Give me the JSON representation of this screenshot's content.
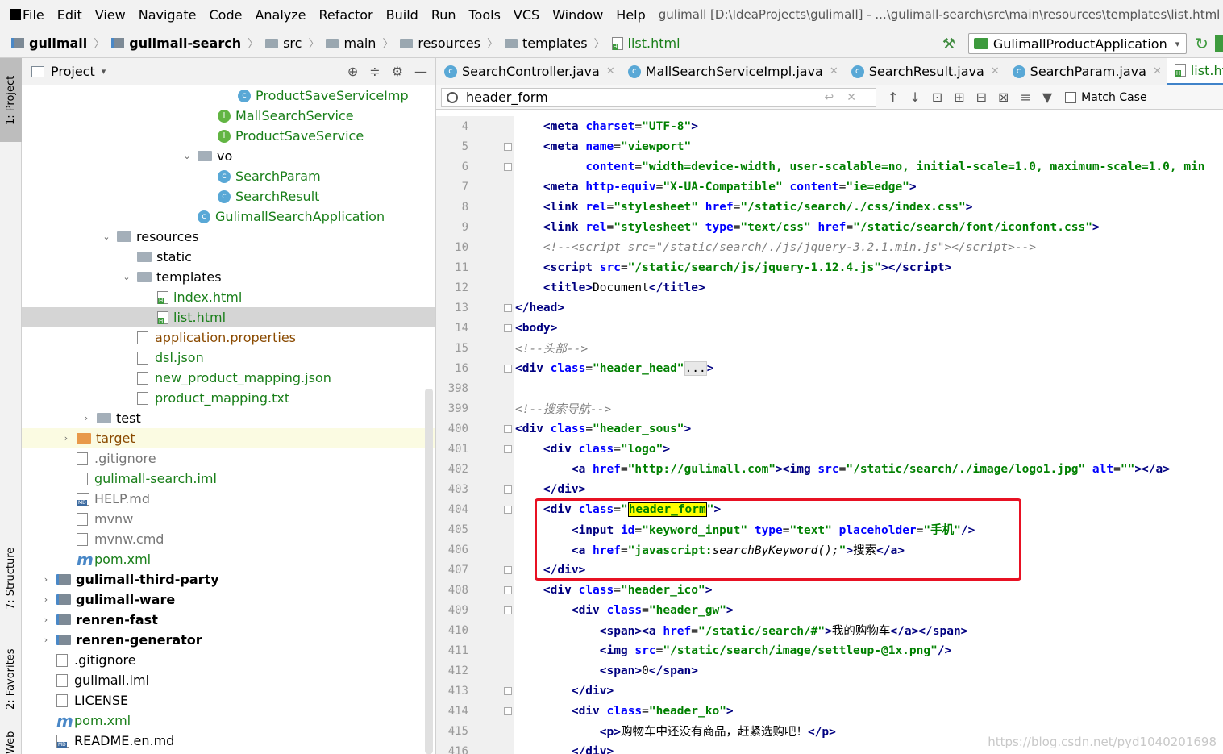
{
  "menu": [
    "File",
    "Edit",
    "View",
    "Navigate",
    "Code",
    "Analyze",
    "Refactor",
    "Build",
    "Run",
    "Tools",
    "VCS",
    "Window",
    "Help"
  ],
  "window_title": "gulimall [D:\\IdeaProjects\\gulimall] - ...\\gulimall-search\\src\\main\\resources\\templates\\list.html [gulima",
  "breadcrumbs": [
    "gulimall",
    "gulimall-search",
    "src",
    "main",
    "resources",
    "templates",
    "list.html"
  ],
  "run_config": "GulimallProductApplication",
  "sidebar_tabs": [
    "1: Project",
    "7: Structure",
    "2: Favorites",
    "Web"
  ],
  "project_panel_title": "Project",
  "tree": [
    {
      "label": "ProductSaveServiceImp",
      "icon": "class",
      "indent": 10,
      "color": "green"
    },
    {
      "label": "MallSearchService",
      "icon": "interface",
      "indent": 9,
      "color": "green"
    },
    {
      "label": "ProductSaveService",
      "icon": "interface",
      "indent": 9,
      "color": "green"
    },
    {
      "label": "vo",
      "icon": "folder",
      "indent": 8,
      "arrow": "open"
    },
    {
      "label": "SearchParam",
      "icon": "class",
      "indent": 9,
      "color": "green"
    },
    {
      "label": "SearchResult",
      "icon": "class",
      "indent": 9,
      "color": "green"
    },
    {
      "label": "GulimallSearchApplication",
      "icon": "class",
      "indent": 8,
      "color": "green"
    },
    {
      "label": "resources",
      "icon": "folder",
      "indent": 4,
      "arrow": "open"
    },
    {
      "label": "static",
      "icon": "folder",
      "indent": 5
    },
    {
      "label": "templates",
      "icon": "folder",
      "indent": 5,
      "arrow": "open"
    },
    {
      "label": "index.html",
      "icon": "html",
      "indent": 6,
      "color": "green"
    },
    {
      "label": "list.html",
      "icon": "html",
      "indent": 6,
      "color": "green",
      "selected": true
    },
    {
      "label": "application.properties",
      "icon": "file",
      "indent": 5,
      "color": "brown"
    },
    {
      "label": "dsl.json",
      "icon": "file",
      "indent": 5,
      "color": "green"
    },
    {
      "label": "new_product_mapping.json",
      "icon": "file",
      "indent": 5,
      "color": "green"
    },
    {
      "label": "product_mapping.txt",
      "icon": "file",
      "indent": 5,
      "color": "green"
    },
    {
      "label": "test",
      "icon": "folder",
      "indent": 3,
      "arrow": "closed"
    },
    {
      "label": "target",
      "icon": "folder-orange",
      "indent": 2,
      "arrow": "closed",
      "color": "brown",
      "highlight": true
    },
    {
      "label": ".gitignore",
      "icon": "file",
      "indent": 2,
      "color": "gray"
    },
    {
      "label": "gulimall-search.iml",
      "icon": "file",
      "indent": 2,
      "color": "green"
    },
    {
      "label": "HELP.md",
      "icon": "md",
      "indent": 2,
      "color": "gray"
    },
    {
      "label": "mvnw",
      "icon": "file",
      "indent": 2,
      "color": "gray"
    },
    {
      "label": "mvnw.cmd",
      "icon": "file",
      "indent": 2,
      "color": "gray"
    },
    {
      "label": "pom.xml",
      "icon": "maven",
      "indent": 2,
      "color": "green"
    },
    {
      "label": "gulimall-third-party",
      "icon": "module",
      "indent": 1,
      "arrow": "closed",
      "bold": true
    },
    {
      "label": "gulimall-ware",
      "icon": "module",
      "indent": 1,
      "arrow": "closed",
      "bold": true
    },
    {
      "label": "renren-fast",
      "icon": "module",
      "indent": 1,
      "arrow": "closed",
      "bold": true
    },
    {
      "label": "renren-generator",
      "icon": "module",
      "indent": 1,
      "arrow": "closed",
      "bold": true
    },
    {
      "label": ".gitignore",
      "icon": "file",
      "indent": 1
    },
    {
      "label": "gulimall.iml",
      "icon": "file",
      "indent": 1
    },
    {
      "label": "LICENSE",
      "icon": "file",
      "indent": 1
    },
    {
      "label": "pom.xml",
      "icon": "maven",
      "indent": 1,
      "color": "green"
    },
    {
      "label": "README.en.md",
      "icon": "md",
      "indent": 1
    }
  ],
  "tabs": [
    {
      "label": "SearchController.java"
    },
    {
      "label": "MallSearchServiceImpl.java"
    },
    {
      "label": "SearchResult.java"
    },
    {
      "label": "SearchParam.java"
    },
    {
      "label": "list.html",
      "active": true
    }
  ],
  "search": {
    "query": "header_form",
    "match_case_label": "Match Case"
  },
  "code_lines": [
    {
      "n": "4",
      "html": "    <span class=\"t\">&lt;meta </span><span class=\"a\">charset</span><span class=\"p\">=</span><span class=\"v\">\"UTF-8\"</span><span class=\"t\">&gt;</span>"
    },
    {
      "n": "5",
      "html": "    <span class=\"t\">&lt;meta </span><span class=\"a\">name</span><span class=\"p\">=</span><span class=\"v\">\"viewport\"</span>",
      "fold": true
    },
    {
      "n": "6",
      "html": "          <span class=\"a\">content</span><span class=\"p\">=</span><span class=\"v\">\"width=device-width, user-scalable=no, initial-scale=1.0, maximum-scale=1.0, min</span>",
      "fold": true
    },
    {
      "n": "7",
      "html": "    <span class=\"t\">&lt;meta </span><span class=\"a\">http-equiv</span><span class=\"p\">=</span><span class=\"v\">\"X-UA-Compatible\"</span> <span class=\"a\">content</span><span class=\"p\">=</span><span class=\"v\">\"ie=edge\"</span><span class=\"t\">&gt;</span>"
    },
    {
      "n": "8",
      "html": "    <span class=\"t\">&lt;link </span><span class=\"a\">rel</span><span class=\"p\">=</span><span class=\"v\">\"stylesheet\"</span> <span class=\"a\">href</span><span class=\"p\">=</span><span class=\"v\">\"/static/search/./css/index.css\"</span><span class=\"t\">&gt;</span>"
    },
    {
      "n": "9",
      "html": "    <span class=\"t\">&lt;link </span><span class=\"a\">rel</span><span class=\"p\">=</span><span class=\"v\">\"stylesheet\"</span> <span class=\"a\">type</span><span class=\"p\">=</span><span class=\"v\">\"text/css\"</span> <span class=\"a\">href</span><span class=\"p\">=</span><span class=\"v\">\"/static/search/font/iconfont.css\"</span><span class=\"t\">&gt;</span>"
    },
    {
      "n": "10",
      "html": "    <span class=\"c\">&lt;!--&lt;script src=\"/static/search/./js/jquery-3.2.1.min.js\"&gt;&lt;/script&gt;--&gt;</span>"
    },
    {
      "n": "11",
      "html": "    <span class=\"t\">&lt;script </span><span class=\"a\">src</span><span class=\"p\">=</span><span class=\"v\">\"/static/search/js/jquery-1.12.4.js\"</span><span class=\"t\">&gt;&lt;/script&gt;</span>"
    },
    {
      "n": "12",
      "html": "    <span class=\"t\">&lt;title&gt;</span>Document<span class=\"t\">&lt;/title&gt;</span>"
    },
    {
      "n": "13",
      "html": "<span class=\"t\">&lt;/head&gt;</span>",
      "fold": true
    },
    {
      "n": "14",
      "html": "<span class=\"t\">&lt;body&gt;</span>",
      "fold": true
    },
    {
      "n": "15",
      "html": "<span class=\"c\">&lt;!--头部--&gt;</span>"
    },
    {
      "n": "16",
      "html": "<span class=\"t\">&lt;div </span><span class=\"a\">class</span><span class=\"p\">=</span><span class=\"v\">\"header_head\"</span><span class=\"fld\">...</span><span class=\"t\">&gt;</span>",
      "fold": true
    },
    {
      "n": "398",
      "html": ""
    },
    {
      "n": "399",
      "html": "<span class=\"c\">&lt;!--搜索导航--&gt;</span>"
    },
    {
      "n": "400",
      "html": "<span class=\"t\">&lt;div </span><span class=\"a\">class</span><span class=\"p\">=</span><span class=\"v\">\"header_sous\"</span><span class=\"t\">&gt;</span>",
      "fold": true
    },
    {
      "n": "401",
      "html": "    <span class=\"t\">&lt;div </span><span class=\"a\">class</span><span class=\"p\">=</span><span class=\"v\">\"logo\"</span><span class=\"t\">&gt;</span>",
      "fold": true
    },
    {
      "n": "402",
      "html": "        <span class=\"t\">&lt;a </span><span class=\"a\">href</span><span class=\"p\">=</span><span class=\"v\">\"http://gulimall.com\"</span><span class=\"t\">&gt;&lt;img </span><span class=\"a\">src</span><span class=\"p\">=</span><span class=\"v\">\"/static/search/./image/logo1.jpg\"</span> <span class=\"a\">alt</span><span class=\"p\">=</span><span class=\"v\">\"\"</span><span class=\"t\">&gt;&lt;/a&gt;</span>"
    },
    {
      "n": "403",
      "html": "    <span class=\"t\">&lt;/div&gt;</span>",
      "fold": true
    },
    {
      "n": "404",
      "html": "    <span class=\"t\">&lt;div </span><span class=\"a\">class</span><span class=\"p\">=</span><span class=\"v\">\"</span><span class=\"match\">header_form</span><span class=\"v\">\"</span><span class=\"t\">&gt;</span>",
      "fold": true
    },
    {
      "n": "405",
      "html": "        <span class=\"t\">&lt;input </span><span class=\"a\">id</span><span class=\"p\">=</span><span class=\"v\">\"keyword_input\"</span> <span class=\"a\">type</span><span class=\"p\">=</span><span class=\"v\">\"text\"</span> <span class=\"a\">placeholder</span><span class=\"p\">=</span><span class=\"v\">\"手机\"</span><span class=\"t\">/&gt;</span>"
    },
    {
      "n": "406",
      "html": "        <span class=\"t\">&lt;a </span><span class=\"a\">href</span><span class=\"p\">=</span><span class=\"v\">\"javascript:</span><span class=\"p\" style=\"font-style:italic\">searchByKeyword();</span><span class=\"v\">\"</span><span class=\"t\">&gt;</span>搜索<span class=\"t\">&lt;/a&gt;</span>"
    },
    {
      "n": "407",
      "html": "    <span class=\"t\">&lt;/div&gt;</span>",
      "fold": true
    },
    {
      "n": "408",
      "html": "    <span class=\"t\">&lt;div </span><span class=\"a\">class</span><span class=\"p\">=</span><span class=\"v\">\"header_ico\"</span><span class=\"t\">&gt;</span>",
      "fold": true
    },
    {
      "n": "409",
      "html": "        <span class=\"t\">&lt;div </span><span class=\"a\">class</span><span class=\"p\">=</span><span class=\"v\">\"header_gw\"</span><span class=\"t\">&gt;</span>",
      "fold": true
    },
    {
      "n": "410",
      "html": "            <span class=\"t\">&lt;span&gt;&lt;a </span><span class=\"a\">href</span><span class=\"p\">=</span><span class=\"v\">\"/static/search/#\"</span><span class=\"t\">&gt;</span>我的购物车<span class=\"t\">&lt;/a&gt;&lt;/span&gt;</span>"
    },
    {
      "n": "411",
      "html": "            <span class=\"t\">&lt;img </span><span class=\"a\">src</span><span class=\"p\">=</span><span class=\"v\">\"/static/search/image/settleup-@1x.png\"</span><span class=\"t\">/&gt;</span>"
    },
    {
      "n": "412",
      "html": "            <span class=\"t\">&lt;span&gt;</span>0<span class=\"t\">&lt;/span&gt;</span>"
    },
    {
      "n": "413",
      "html": "        <span class=\"t\">&lt;/div&gt;</span>",
      "fold": true
    },
    {
      "n": "414",
      "html": "        <span class=\"t\">&lt;div </span><span class=\"a\">class</span><span class=\"p\">=</span><span class=\"v\">\"header_ko\"</span><span class=\"t\">&gt;</span>",
      "fold": true
    },
    {
      "n": "415",
      "html": "            <span class=\"t\">&lt;p&gt;</span>购物车中还没有商品，赶紧选购吧！<span class=\"t\">&lt;/p&gt;</span>"
    },
    {
      "n": "416",
      "html": "        <span class=\"t\">&lt;/div&gt;</span>"
    }
  ],
  "watermark": "https://blog.csdn.net/pyd1040201698"
}
